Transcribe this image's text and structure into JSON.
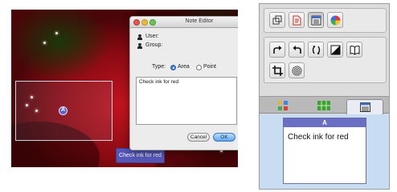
{
  "canvas": {
    "annotation_marker": "A",
    "callout_text": "Check ink for red"
  },
  "note_editor": {
    "title": "Note Editor",
    "user_label": "User:",
    "group_label": "Group:",
    "type_label": "Type:",
    "type_options": [
      {
        "label": "Area",
        "selected": true
      },
      {
        "label": "Point",
        "selected": false
      }
    ],
    "note_text": "Check ink for red",
    "cancel_label": "Cancel",
    "ok_label": "OK"
  },
  "palette": {
    "tools_row1": [
      "layers-icon",
      "document-icon",
      "list-icon",
      "color-wheel-icon"
    ],
    "tools_row2": [
      "redo-icon",
      "undo-icon",
      "rotate-icon",
      "contrast-icon",
      "book-icon"
    ],
    "tools_row3": [
      "crop-icon",
      "spiral-icon"
    ],
    "tabs": [
      "grid-view-icon",
      "thumbnail-icon",
      "notes-icon"
    ],
    "active_tab": "notes-icon",
    "note_card": {
      "label": "A",
      "text": "Check ink for red"
    }
  },
  "colors": {
    "annotation_accent": "#5558b8",
    "ok_button": "#5fa4ec",
    "preview_background": "#c8dcf2"
  }
}
